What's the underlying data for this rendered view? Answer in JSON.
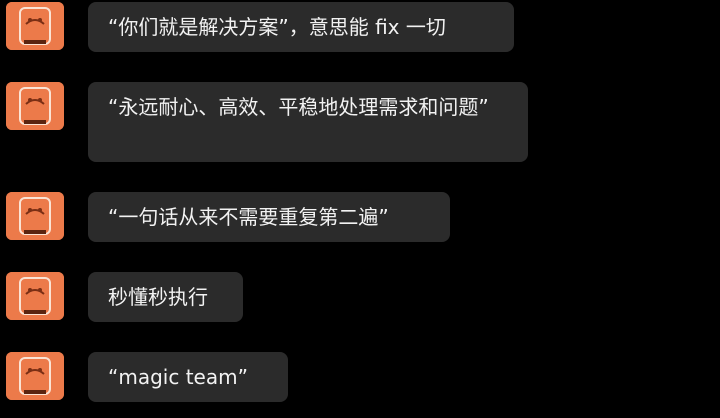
{
  "chat": {
    "messages": [
      {
        "text": "“你们就是解决方案”，意思能 fix 一切",
        "avatar": "orange-illustrated-avatar"
      },
      {
        "text": "“永远耐心、高效、平稳地处理需求和问题”",
        "avatar": "orange-illustrated-avatar"
      },
      {
        "text": "“一句话从来不需要重复第二遍”",
        "avatar": "orange-illustrated-avatar"
      },
      {
        "text": "秒懂秒执行",
        "avatar": "orange-illustrated-avatar"
      },
      {
        "text": "“magic team”",
        "avatar": "orange-illustrated-avatar"
      }
    ]
  },
  "colors": {
    "background": "#000000",
    "bubble": "#2b2b2b",
    "bubble_text": "#f2f2f2",
    "avatar_bg": "#ec7a4a"
  }
}
